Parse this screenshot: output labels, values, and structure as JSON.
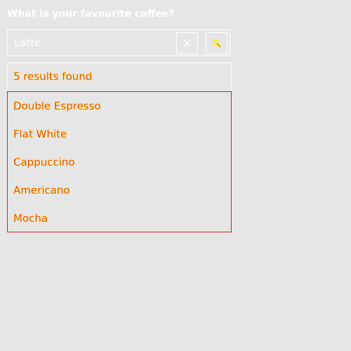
{
  "question": "What is your favourite coffee?",
  "search": {
    "value": "Latte",
    "clear_glyph": "✕",
    "search_icon": "search-icon",
    "clear_icon": "close-icon"
  },
  "status": {
    "text": "5 results found"
  },
  "results": [
    {
      "label": "Double Espresso"
    },
    {
      "label": "Flat White"
    },
    {
      "label": "Cappuccino"
    },
    {
      "label": "Americano"
    },
    {
      "label": "Mocha"
    }
  ],
  "colors": {
    "background": "#e6e6e6",
    "text_foreground": "#e01010",
    "text_outline": "#ffee00",
    "border": "#ffffff",
    "list_border": "#d82020"
  }
}
